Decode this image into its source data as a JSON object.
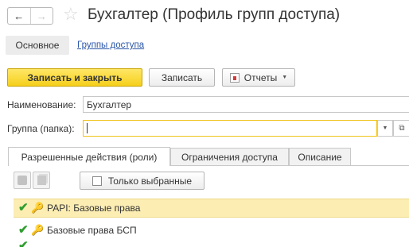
{
  "nav": {
    "back_icon": "←",
    "forward_icon": "→",
    "star_icon": "☆"
  },
  "window": {
    "title": "Бухгалтер (Профиль групп доступа)"
  },
  "top_tabs": {
    "main": "Основное",
    "link": "Группы доступа"
  },
  "toolbar": {
    "save_close": "Записать и закрыть",
    "save": "Записать",
    "reports": "Отчеты",
    "primary_color": "#f5cf1b"
  },
  "fields": {
    "name_label": "Наименование:",
    "name_value": "Бухгалтер",
    "group_label": "Группа (папка):",
    "group_value": ""
  },
  "lower_tabs": [
    "Разрешенные действия (роли)",
    "Ограничения доступа",
    "Описание"
  ],
  "roles_toolbar": {
    "only_selected": "Только выбранные"
  },
  "roles": [
    {
      "name": "РАРІ: Базовые права",
      "checked": true,
      "selected": true
    },
    {
      "name": "Базовые права БСП",
      "checked": true,
      "selected": false
    },
    {
      "name": "",
      "checked": true,
      "selected": false
    }
  ]
}
